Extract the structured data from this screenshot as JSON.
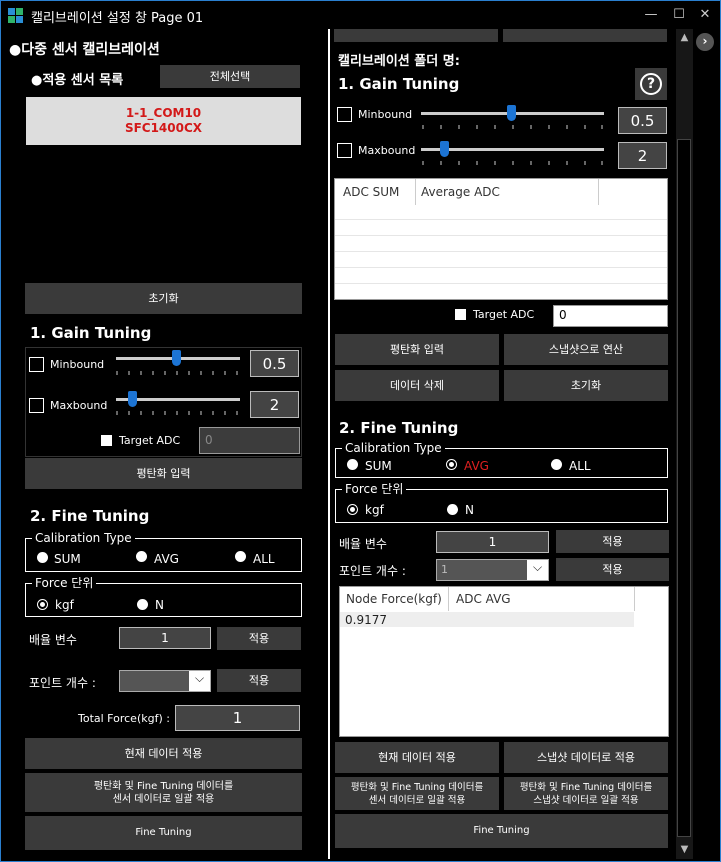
{
  "window": {
    "title": "캘리브레이션 설정 창 Page 01",
    "controls": {
      "minimize": "—",
      "maximize": "☐",
      "close": "✕"
    },
    "colors": {
      "accent": "#1c74d4",
      "border": "#2a7fcf",
      "error_red": "#d31919"
    }
  },
  "left": {
    "section_title": "●다중 센서 캘리브레이션",
    "sensor_list_label": "●적용 센서 목록",
    "select_all_button": "전체선택",
    "sensors": [
      {
        "line1": "1-1_COM10",
        "line2": "SFC1400CX"
      }
    ],
    "reset_button": "초기화",
    "gain_tuning": {
      "title": "1. Gain Tuning",
      "minbound_label": "Minbound",
      "minbound_value": "0.5",
      "minbound_slider_fraction": 0.5,
      "maxbound_label": "Maxbound",
      "maxbound_value": "2",
      "maxbound_slider_fraction": 0.1,
      "target_adc_label": "Target ADC",
      "target_adc_value": "0",
      "flatten_input_button": "평탄화 입력"
    },
    "fine_tuning": {
      "title": "2. Fine Tuning",
      "calibration_type_title": "Calibration Type",
      "calibration_types": [
        "SUM",
        "AVG",
        "ALL"
      ],
      "calibration_type_selected": "none",
      "force_unit_title": "Force 단위",
      "force_units": [
        "kgf",
        "N"
      ],
      "force_unit_selected": "kgf",
      "multiplier_label": "배율 변수",
      "multiplier_value": "1",
      "apply_button": "적용",
      "point_count_label": "포인트 개수 :",
      "point_count_value": "",
      "total_force_label": "Total Force(kgf) :",
      "total_force_value": "1",
      "apply_current_button": "현재 데이터 적용",
      "bulk_apply_line1": "평탄화 및 Fine Tuning 데이터를",
      "bulk_apply_line2": "센서 데이터로 일괄 적용",
      "fine_tuning_button": "Fine Tuning"
    }
  },
  "right": {
    "folder_label": "캘리브레이션 폴더 명:",
    "gain_tuning": {
      "title": "1. Gain Tuning",
      "help_icon": "?",
      "minbound_label": "Minbound",
      "minbound_value": "0.5",
      "minbound_slider_fraction": 0.5,
      "maxbound_label": "Maxbound",
      "maxbound_value": "2",
      "maxbound_slider_fraction": 0.1,
      "table_headers": [
        "ADC SUM",
        "Average ADC",
        ""
      ],
      "target_adc_label": "Target ADC",
      "target_adc_value": "0",
      "flatten_input_button": "평탄화 입력",
      "snapshot_compute_button": "스냅샷으로 연산",
      "delete_data_button": "데이터 삭제",
      "reset_button": "초기화"
    },
    "fine_tuning": {
      "title": "2. Fine Tuning",
      "calibration_type_title": "Calibration Type",
      "calibration_types": [
        "SUM",
        "AVG",
        "ALL"
      ],
      "calibration_type_selected": "AVG",
      "force_unit_title": "Force 단위",
      "force_units": [
        "kgf",
        "N"
      ],
      "force_unit_selected": "kgf",
      "multiplier_label": "배율 변수",
      "multiplier_value": "1",
      "apply_button": "적용",
      "point_count_label": "포인트 개수 :",
      "point_count_value": "1",
      "table_headers": [
        "Node Force(kgf)",
        "ADC AVG"
      ],
      "table_rows": [
        [
          "0.9177",
          ""
        ]
      ],
      "apply_current_button": "현재 데이터 적용",
      "apply_snapshot_button": "스냅샷 데이터로 적용",
      "bulk_apply_sensor_line1": "평탄화 및 Fine Tuning 데이터를",
      "bulk_apply_sensor_line2": "센서 데이터로 일괄 적용",
      "bulk_apply_snapshot_line1": "평탄화 및 Fine Tuning 데이터를",
      "bulk_apply_snapshot_line2": "스냅샷 데이터로 일괄 적용",
      "fine_tuning_button": "Fine Tuning"
    }
  }
}
